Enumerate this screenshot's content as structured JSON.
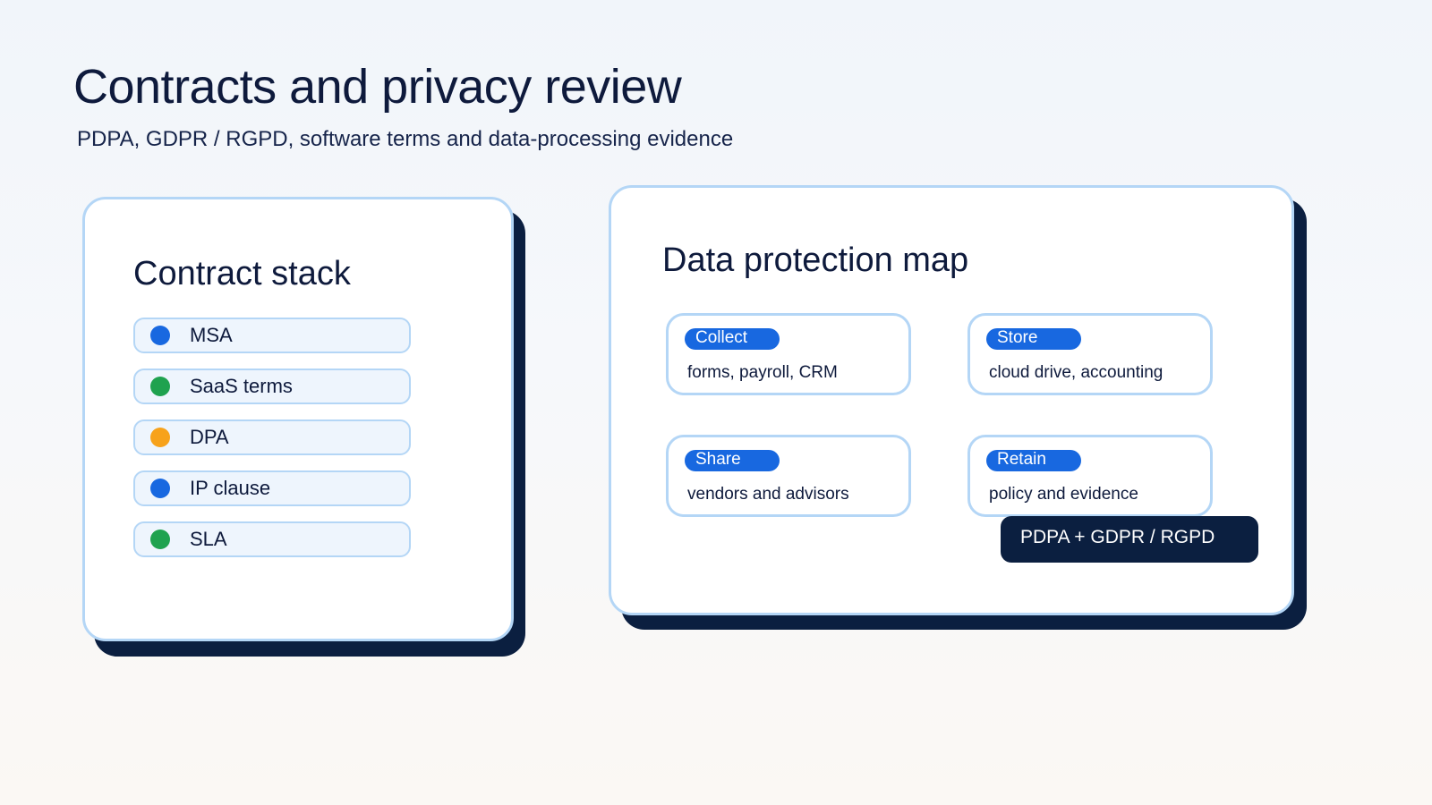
{
  "header": {
    "title": "Contracts and privacy review",
    "subtitle": "PDPA, GDPR / RGPD, software terms and data-processing evidence"
  },
  "contract_stack": {
    "title": "Contract stack",
    "items": [
      {
        "label": "MSA",
        "color": "#1868e0"
      },
      {
        "label": "SaaS terms",
        "color": "#1fa24f"
      },
      {
        "label": "DPA",
        "color": "#f7a21b"
      },
      {
        "label": "IP clause",
        "color": "#1868e0"
      },
      {
        "label": "SLA",
        "color": "#1fa24f"
      }
    ]
  },
  "data_protection_map": {
    "title": "Data protection map",
    "cards": [
      {
        "tag": "Collect",
        "description": "forms, payroll, CRM"
      },
      {
        "tag": "Store",
        "description": "cloud drive, accounting"
      },
      {
        "tag": "Share",
        "description": "vendors and advisors"
      },
      {
        "tag": "Retain",
        "description": "policy and evidence"
      }
    ],
    "badge": "PDPA + GDPR / RGPD"
  },
  "colors": {
    "accent": "#1868e0",
    "panel_border": "#b4d6f6",
    "navy": "#0b1f40"
  }
}
